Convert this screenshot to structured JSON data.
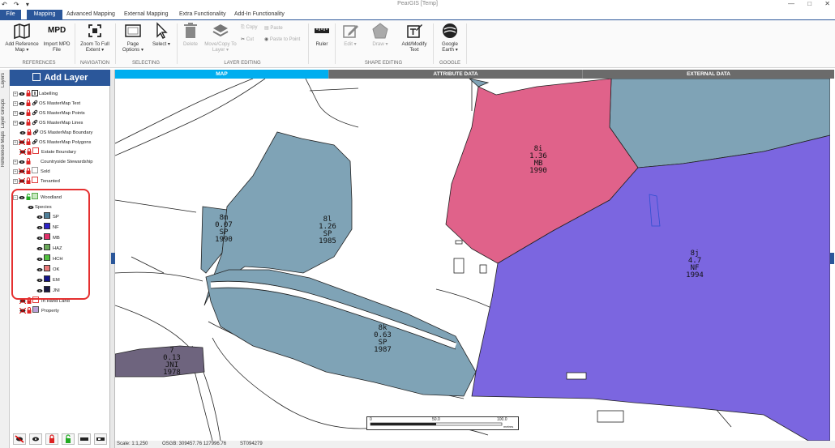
{
  "window": {
    "title": "PearGIS [Temp]",
    "min": "—",
    "max": "□",
    "close": "✕"
  },
  "quick_access": "↶ ↷ ▾",
  "tabs": [
    "File",
    "Mapping",
    "Advanced Mapping",
    "External Mapping",
    "Extra Functionality",
    "Add-In Functionality"
  ],
  "ribbon": {
    "add_reference_map": "Add Reference Map ▾",
    "import_mpd": "Import MPD File",
    "mpd_icon_text": "MPD",
    "zoom_full": "Zoom To Full Extent ▾",
    "page_options": "Page Options ▾",
    "select": "Select ▾",
    "delete": "Delete",
    "move_copy": "Move/Copy To Layer ▾",
    "copy": "Copy",
    "cut": "Cut",
    "paste": "Paste",
    "paste_to_point": "Paste to Point",
    "ruler": "Ruler",
    "edit": "Edit ▾",
    "draw": "Draw ▾",
    "add_modify_text": "Add/Modify Text",
    "google_earth": "Google Earth ▾",
    "groups": {
      "references": "REFERENCES",
      "navigation": "NAVIGATION",
      "selecting": "SELECTING",
      "layer_editing": "LAYER EDITING",
      "shape_editing": "SHAPE EDITING",
      "google": "GOOGLE"
    }
  },
  "side_tabs": [
    "Layers",
    "Layer Groups",
    "Reference Maps"
  ],
  "panel": {
    "add_layer": "Add Layer",
    "layers": [
      {
        "label": "Labelling"
      },
      {
        "label": "OS MasterMap Text"
      },
      {
        "label": "OS MasterMap Points"
      },
      {
        "label": "OS MasterMap Lines"
      },
      {
        "label": "OS MasterMap Boundary"
      },
      {
        "label": "OS MasterMap Polygons"
      },
      {
        "label": "Estate Boundary"
      },
      {
        "label": "Countryside Stewardship"
      },
      {
        "label": "Sold"
      },
      {
        "label": "Tenanted"
      },
      {
        "label": "Woodland"
      },
      {
        "label": "Species"
      },
      {
        "label": "In Hand Land"
      },
      {
        "label": "Property"
      }
    ],
    "species": [
      {
        "label": "SP",
        "color": "#4f7f99"
      },
      {
        "label": "NF",
        "color": "#2e22c8"
      },
      {
        "label": "MB",
        "color": "#e0306a"
      },
      {
        "label": "HAZ",
        "color": "#6aa95a"
      },
      {
        "label": "HCH",
        "color": "#52c040"
      },
      {
        "label": "OK",
        "color": "#e87878"
      },
      {
        "label": "EM",
        "color": "#121288"
      },
      {
        "label": "JNI",
        "color": "#1a1a40"
      }
    ]
  },
  "map_tabs": [
    "MAP",
    "ATTRIBUTE DATA",
    "EXTERNAL DATA"
  ],
  "parcels": [
    {
      "label": "8i\n1.36\nMB\n1990"
    },
    {
      "label": "8m\n0.07\nSP\n1990"
    },
    {
      "label": "8l\n1.26\nSP\n1985"
    },
    {
      "label": "8j\n4.7\nNF\n1994"
    },
    {
      "label": "8k\n0.63\nSP\n1987"
    },
    {
      "label": "7\n0.13\nJNI\n1978"
    }
  ],
  "scalebar": {
    "ticks": [
      "0",
      "50.0",
      "100.0"
    ],
    "unit": "metres"
  },
  "status": {
    "scale": "Scale: 1:1,250",
    "osgb": "OSGB: 309457.76 127996.76",
    "grid": "ST094279"
  }
}
